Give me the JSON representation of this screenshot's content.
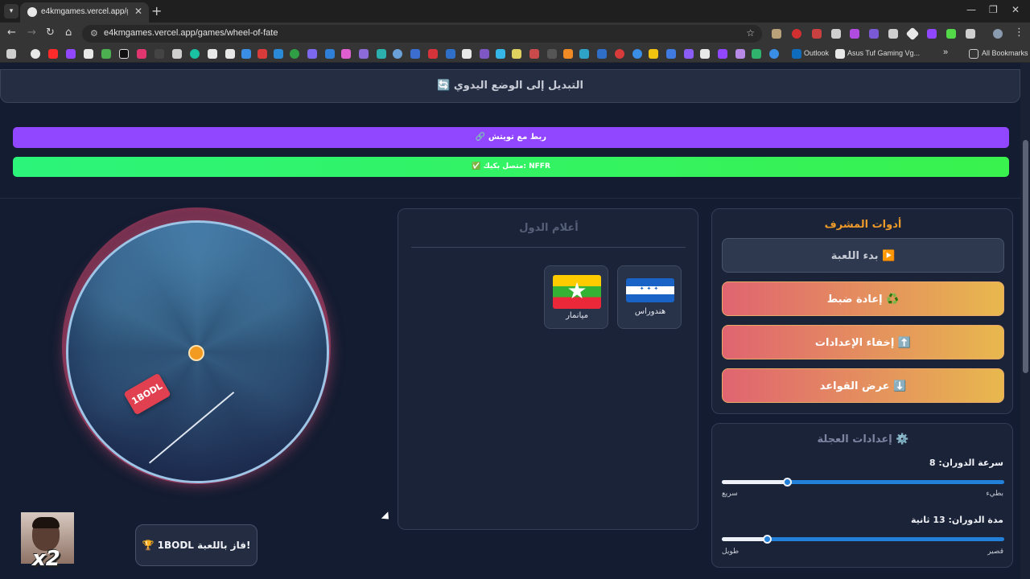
{
  "browser": {
    "tab_title": "e4kmgames.vercel.app/games/",
    "url": "e4kmgames.vercel.app/games/wheel-of-fate",
    "bookmarks": {
      "outlook": "Outlook",
      "asus": "Asus Tuf Gaming Vg...",
      "all": "All Bookmarks"
    }
  },
  "page": {
    "manual_mode_label": "🔄 التبديل إلى الوضع اليدوي",
    "twitch_connect_label": "🔗 ربط مع تويتش",
    "connected_label": "✅ متصل بكيك: NFFR"
  },
  "wheel": {
    "tag_label": "1BODL",
    "winner_text": "🏆 1BODL فاز باللعبة!",
    "webcam_badge": "x2"
  },
  "flags": {
    "title": "أعلام الدول",
    "items": [
      {
        "name": "هندوراس",
        "flag": "honduras"
      },
      {
        "name": "ميانمار",
        "flag": "myanmar"
      }
    ]
  },
  "admin": {
    "title": "أدوات المشرف",
    "start": "بدء اللعبة ▶️",
    "reset": "إعادة ضبط ♻️",
    "hide_settings": "إخفاء الإعدادات ⬆️",
    "show_rules": "عرض القواعد ⬇️"
  },
  "settings": {
    "title": "إعدادات العجلة ⚙️",
    "speed": {
      "label": "سرعة الدوران: 8",
      "min_label": "بطيء",
      "max_label": "سريع",
      "value_fraction": 0.23
    },
    "duration": {
      "label": "مدة الدوران: 13 ثانية",
      "min_label": "قصير",
      "max_label": "طويل",
      "value_fraction": 0.16
    }
  },
  "colors": {
    "twitch": "#9146ff",
    "connected": "#2cf47a",
    "accent_orange": "#ee9a2a",
    "slider": "#2380d9"
  }
}
